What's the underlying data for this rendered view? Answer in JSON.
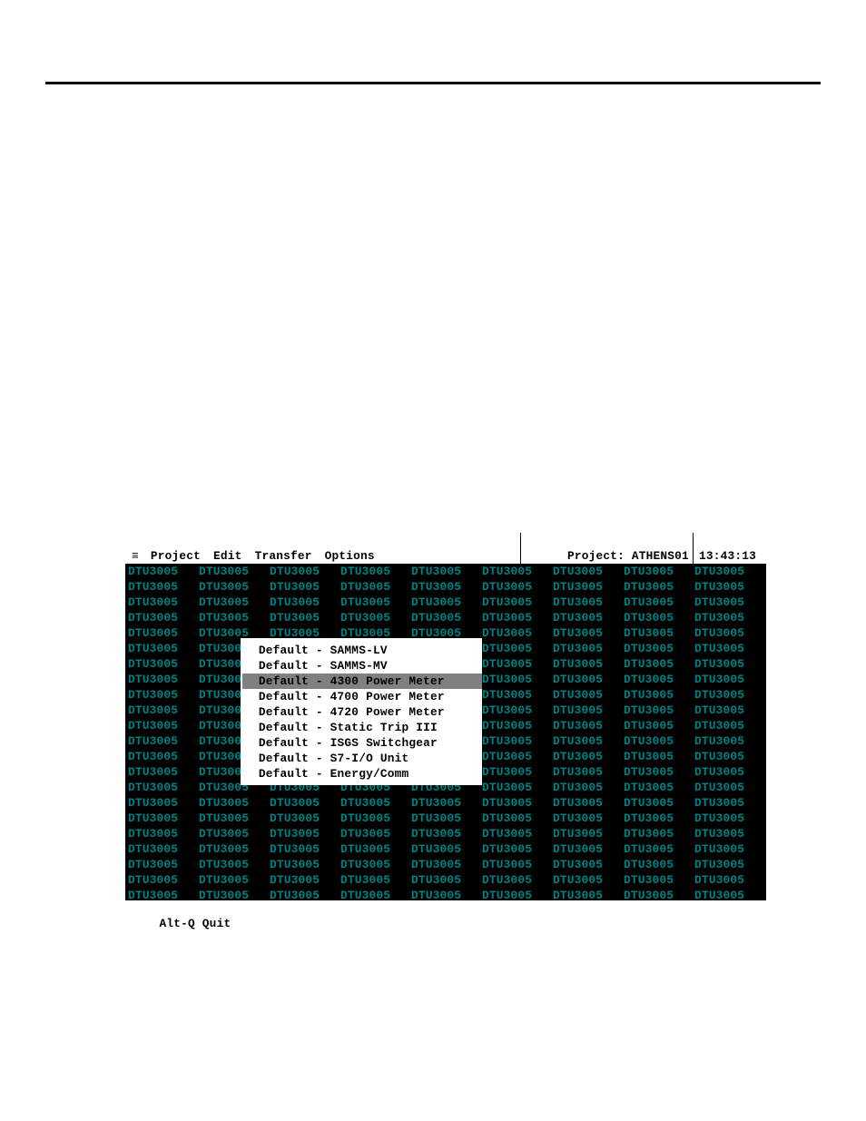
{
  "menubar": {
    "icon": "≡",
    "items": [
      "Project",
      "Edit",
      "Transfer",
      "Options"
    ],
    "project_label": "Project:",
    "project_name": "ATHENS01",
    "clock": "13:43:13"
  },
  "background": {
    "token": "DTU3005",
    "columns": 9,
    "rows": 22
  },
  "popup": {
    "items": [
      "Default - SAMMS-LV",
      "Default - SAMMS-MV",
      "Default - 4300 Power Meter",
      "Default - 4700 Power Meter",
      "Default - 4720 Power Meter",
      "Default - Static Trip III",
      "Default - ISGS Switchgear",
      "Default - S7-I/O Unit",
      "Default - Energy/Comm"
    ],
    "selected_index": 2
  },
  "statusbar": {
    "text": "Alt-Q Quit"
  }
}
